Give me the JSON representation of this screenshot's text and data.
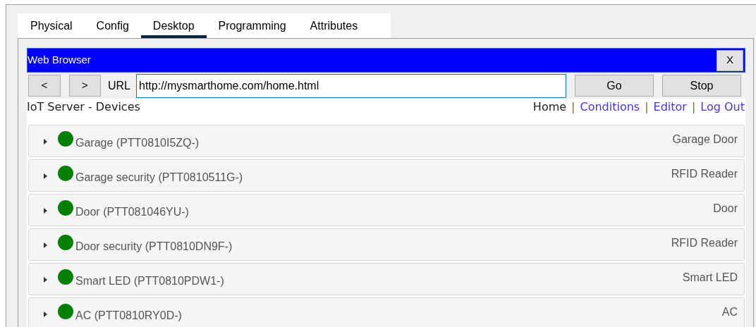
{
  "tabs": [
    {
      "label": "Physical",
      "selected": false
    },
    {
      "label": "Config",
      "selected": false
    },
    {
      "label": "Desktop",
      "selected": true
    },
    {
      "label": "Programming",
      "selected": false
    },
    {
      "label": "Attributes",
      "selected": false
    }
  ],
  "browser": {
    "title": "Web Browser",
    "close": "X",
    "back": "<",
    "forward": ">",
    "url_label": "URL",
    "url": "http://mysmarthome.com/home.html",
    "go": "Go",
    "stop": "Stop"
  },
  "page": {
    "heading": "IoT Server - Devices",
    "nav": [
      {
        "kind": "link",
        "label": "Home",
        "selected": true
      },
      {
        "kind": "separator",
        "label": "|"
      },
      {
        "kind": "link",
        "label": "Conditions",
        "selected": false
      },
      {
        "kind": "separator",
        "label": "|"
      },
      {
        "kind": "link",
        "label": "Editor",
        "selected": false
      },
      {
        "kind": "separator",
        "label": "|"
      },
      {
        "kind": "link",
        "label": "Log Out",
        "selected": false
      }
    ],
    "devices": [
      {
        "name": "Garage (PTT0810I5ZQ-)",
        "type": "Garage Door",
        "expanded": false,
        "color": "#008000"
      },
      {
        "name": "Garage security (PTT0810511G-)",
        "type": "RFID Reader",
        "expanded": false,
        "color": "#008000"
      },
      {
        "name": "Door (PTT081046YU-)",
        "type": "Door",
        "expanded": false,
        "color": "#008000"
      },
      {
        "name": "Door security (PTT0810DN9F-)",
        "type": "RFID Reader",
        "expanded": false,
        "color": "#008000"
      },
      {
        "name": "Smart LED (PTT0810PDW1-)",
        "type": "Smart LED",
        "expanded": false,
        "color": "#008000"
      },
      {
        "name": "AC (PTT0810RY0D-)",
        "type": "AC",
        "expanded": false,
        "color": "#008000"
      }
    ]
  }
}
